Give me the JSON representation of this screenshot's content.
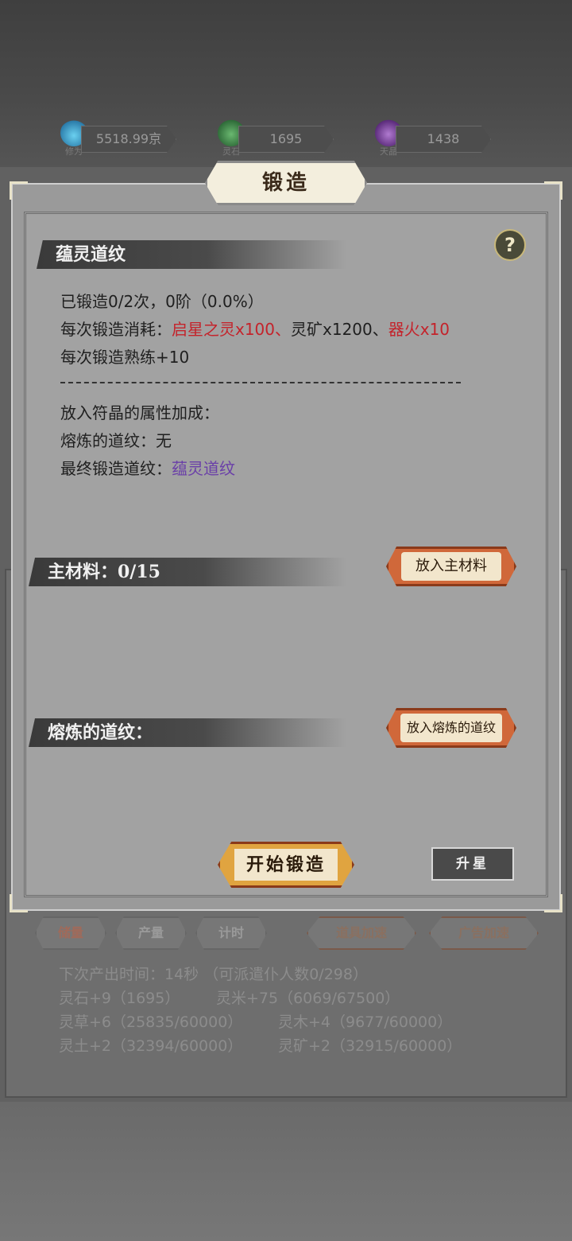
{
  "resources": [
    {
      "label": "修为",
      "value": "5518.99京",
      "icon": "cultivation-flame-icon",
      "color": "#3aa0c8"
    },
    {
      "label": "灵石",
      "value": "1695",
      "icon": "spirit-stone-icon",
      "color": "#3d8a4a"
    },
    {
      "label": "天晶",
      "value": "1438",
      "icon": "sky-crystal-icon",
      "color": "#7a3a9a"
    }
  ],
  "dialog": {
    "title": "锻造",
    "help_label": "?",
    "pattern_section": "蕴灵道纹",
    "forged_status": "已锻造0/2次，0阶（0.0%）",
    "cost_prefix": "每次锻造消耗：",
    "cost_item1": "启星之灵x100、",
    "cost_item2": "灵矿x1200、",
    "cost_item3": "器火x10",
    "proficiency": "每次锻造熟练+10",
    "divider": "————————————————————————",
    "bonus_label": "放入符晶的属性加成：",
    "smelted_prefix": "熔炼的道纹：",
    "smelted_value": "无",
    "final_prefix": "最终锻造道纹：",
    "final_value": "蕴灵道纹",
    "main_material_label": "主材料：0/15",
    "add_main_button": "放入主材料",
    "smelt_section": "熔炼的道纹：",
    "add_smelt_button": "放入熔炼的道纹",
    "start_button": "开始锻造",
    "star_button": "升星"
  },
  "tabs": [
    "储量",
    "产量",
    "计时",
    "道具加速",
    "广告加速"
  ],
  "production": {
    "next_time": "下次产出时间：14秒 （可派遣仆人数0/298）",
    "items": [
      "灵石+9（1695）",
      "灵米+75（6069/67500）",
      "灵草+6（25835/60000）",
      "灵木+4（9677/60000）",
      "灵土+2（32394/60000）",
      "灵矿+2（32915/60000）"
    ]
  },
  "colors": {
    "accent_orange": "#d0683a",
    "cost_red": "#c4232b",
    "pattern_purple": "#6a3fa8"
  }
}
